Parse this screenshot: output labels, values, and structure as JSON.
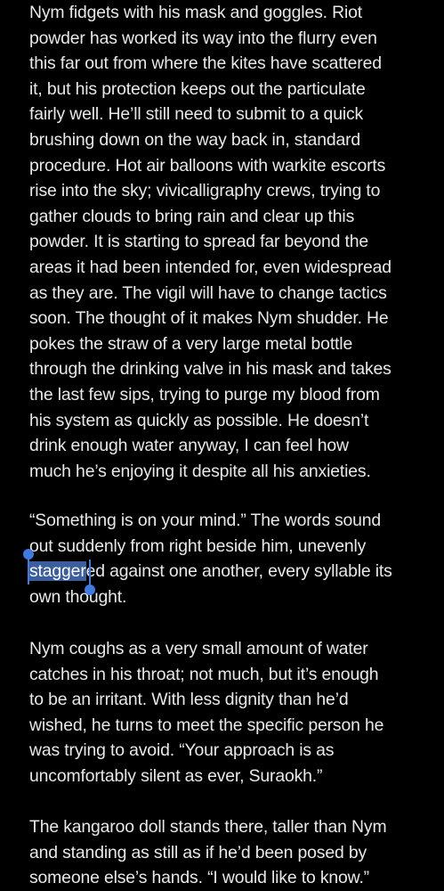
{
  "reader": {
    "paragraphs": [
      {
        "lines": [
          "Nym fidgets with his mask and goggles. Riot",
          "powder has worked its way into the flurry even",
          "this far out from where the kites have scattered",
          "it, but his protection keeps out the particulate",
          "fairly well. He’ll still need to submit to a quick",
          "brushing down on the way back in, standard",
          "procedure. Hot air balloons with warkite escorts",
          "rise into the sky; vivicalligraphy crews, trying to",
          "gather clouds to bring rain and clear up this",
          "powder. It is starting to spread far beyond the",
          "areas it had been intended for, even widespread",
          "as they are. The vigil will have to change tactics",
          "soon. The thought of it makes Nym shudder. He",
          "pokes the straw of a very large metal bottle",
          "through the drinking valve in his mask and takes",
          "the last few sips, trying to purge my blood from",
          "his system as quickly as possible. He doesn’t",
          "drink enough water anyway, I can feel how",
          "much he’s enjoying it despite all his anxieties."
        ]
      },
      {
        "lines": [
          "“Something is on your mind.” The words sound",
          "out suddenly from right beside him, unevenly"
        ],
        "selected_word": "stagger",
        "after_selection": "ed against one another, every syllable its",
        "last_line": "own thought."
      },
      {
        "lines": [
          "Nym coughs as a very small amount of water",
          "catches in his throat; not much, but it’s enough",
          "to be an irritant. With less dignity than he’d",
          "wished, he turns to meet the specific person he",
          "was trying to avoid. “Your approach is as",
          "uncomfortably silent as ever, Suraokh.”"
        ]
      },
      {
        "lines": [
          "The kangaroo doll stands there, taller than Nym",
          "and standing as still as if he’d been posed by",
          "someone else’s hands. “I would like to know.”"
        ]
      }
    ]
  },
  "colors": {
    "background": "#000000",
    "text": "#e8e8e8",
    "selection": "#3b5f9e",
    "handle": "#3d7be0"
  }
}
